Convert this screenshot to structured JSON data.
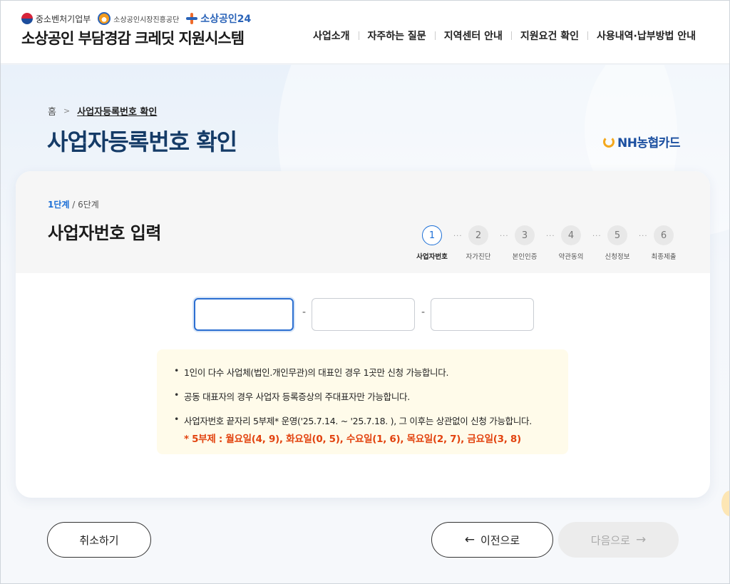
{
  "header": {
    "logos": {
      "ministry": "중소벤처기업부",
      "agency": "소상공인시장진흥공단",
      "portal": "소상공인24"
    },
    "site_title": "소상공인 부담경감 크레딧 지원시스템",
    "nav": [
      {
        "label": "사업소개"
      },
      {
        "label": "자주하는 질문"
      },
      {
        "label": "지역센터 안내"
      },
      {
        "label": "지원요건 확인"
      },
      {
        "label": "사용내역·납부방법 안내"
      }
    ]
  },
  "breadcrumb": {
    "home": "홈",
    "current": "사업자등록번호 확인"
  },
  "page_title": "사업자등록번호 확인",
  "partner_logo": "NH농협카드",
  "card": {
    "step_current": "1단계",
    "step_total": "/ 6단계",
    "title": "사업자번호 입력",
    "steps": [
      {
        "num": "1",
        "label": "사업자번호",
        "active": true
      },
      {
        "num": "2",
        "label": "자가진단",
        "active": false
      },
      {
        "num": "3",
        "label": "본인인증",
        "active": false
      },
      {
        "num": "4",
        "label": "약관동의",
        "active": false
      },
      {
        "num": "5",
        "label": "신청정보",
        "active": false
      },
      {
        "num": "6",
        "label": "최종제출",
        "active": false
      }
    ],
    "inputs": {
      "part1": {
        "value": "",
        "placeholder": ""
      },
      "part2": {
        "value": "",
        "placeholder": ""
      },
      "part3": {
        "value": "",
        "placeholder": ""
      },
      "separator": "-"
    },
    "notices": [
      "1인이 다수 사업체(법인.개인무관)의 대표인 경우 1곳만 신청 가능합니다.",
      "공동 대표자의 경우 사업자 등록증상의 주대표자만 가능합니다.",
      "사업자번호 끝자리 5부제* 운영('25.7.14. ~ '25.7.18. ), 그 이후는 상관없이 신청 가능합니다."
    ],
    "notice_emphasis": "* 5부제 : 월요일(4, 9), 화요일(0, 5), 수요일(1, 6), 목요일(2, 7), 금요일(3, 8)"
  },
  "buttons": {
    "cancel": "취소하기",
    "prev": "이전으로",
    "next": "다음으로"
  },
  "colors": {
    "accent": "#1c6fd6",
    "title": "#153b67",
    "emphasis": "#e2430f",
    "notice_bg": "#fffbea"
  }
}
